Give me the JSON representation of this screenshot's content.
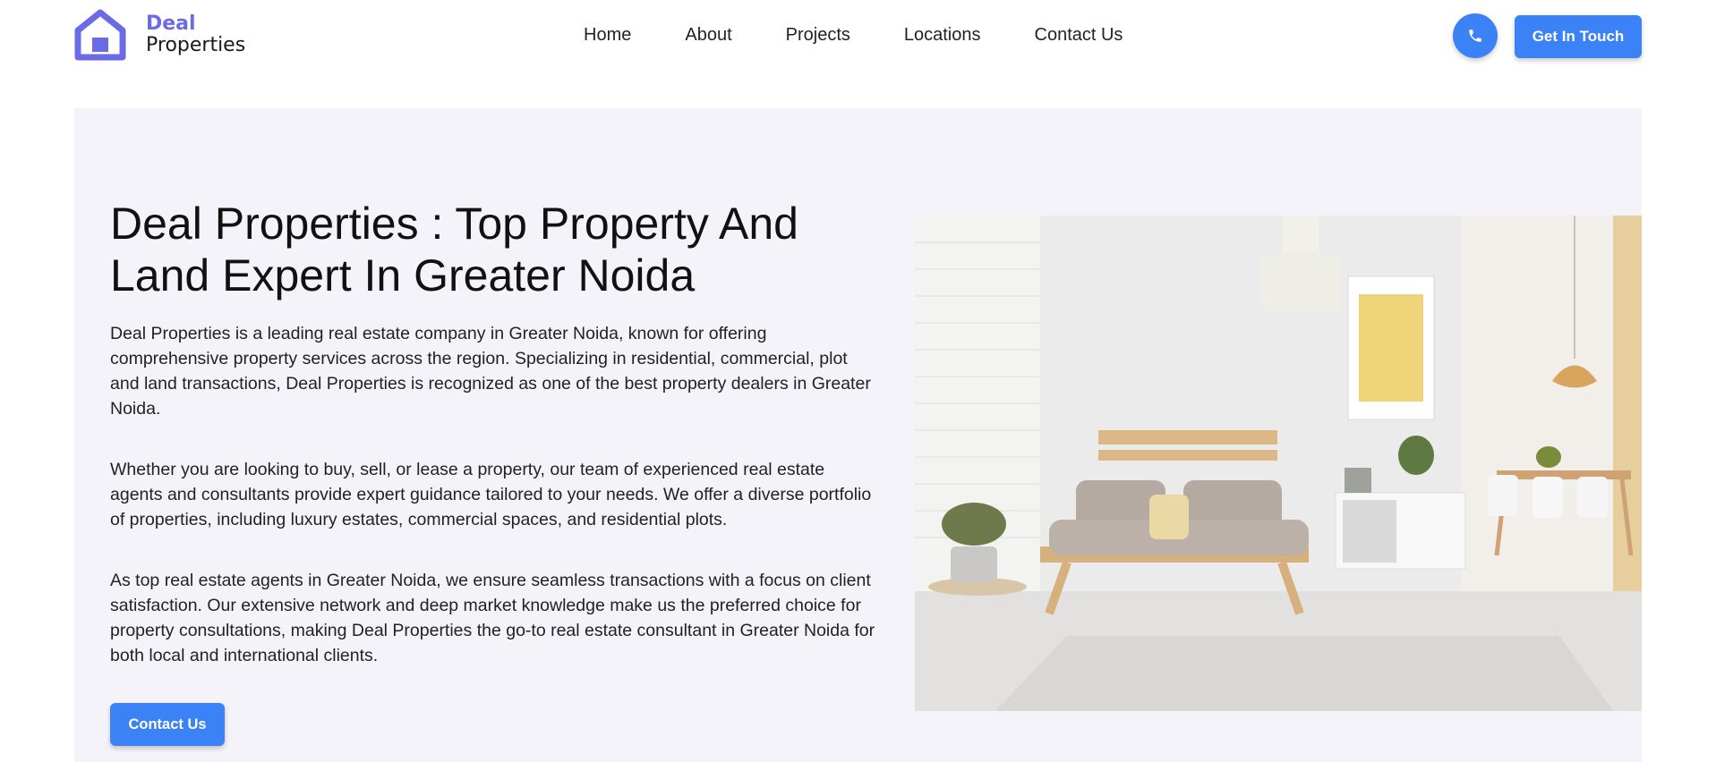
{
  "brand": {
    "line1": "Deal",
    "line2": "Properties",
    "accent": "#6b6be8"
  },
  "nav": {
    "items": [
      "Home",
      "About",
      "Projects",
      "Locations",
      "Contact Us"
    ]
  },
  "header_actions": {
    "phone_icon": "phone-icon",
    "cta_label": "Get In Touch",
    "button_color": "#3b82f6"
  },
  "hero": {
    "title": "Deal Properties : Top Property And Land Expert In Greater Noida",
    "paragraphs": [
      "Deal Properties is a leading real estate company in Greater Noida, known for offering comprehensive property services across the region. Specializing in residential, commercial, plot and land transactions, Deal Properties is recognized as one of the best property dealers in Greater Noida.",
      "Whether you are looking to buy, sell, or lease a property, our team of experienced real estate agents and consultants provide expert guidance tailored to your needs. We offer a diverse portfolio of properties, including luxury estates, commercial spaces, and residential plots.",
      "As top real estate agents in Greater Noida, we ensure seamless transactions with a focus on client satisfaction. Our extensive network and deep market knowledge make us the preferred choice for property consultations, making Deal Properties the go-to real estate consultant in Greater Noida for both local and international clients."
    ],
    "button_label": "Contact Us",
    "background": "#f5f3fa"
  }
}
